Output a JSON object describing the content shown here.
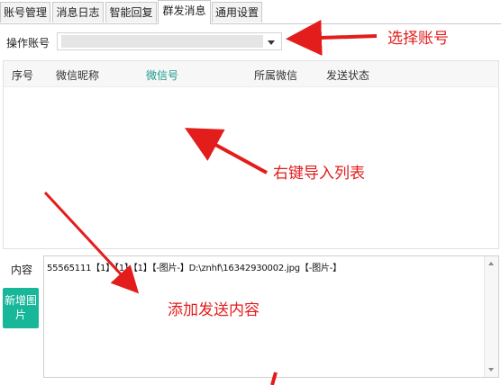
{
  "tabs": [
    {
      "label": "账号管理"
    },
    {
      "label": "消息日志"
    },
    {
      "label": "智能回复"
    },
    {
      "label": "群发消息",
      "active": true
    },
    {
      "label": "通用设置"
    }
  ],
  "account": {
    "label": "操作账号",
    "value": ""
  },
  "list": {
    "headers": [
      "序号",
      "微信昵称",
      "微信号",
      "所属微信",
      "发送状态"
    ]
  },
  "content": {
    "label": "内容",
    "add_image_label": "新增图片",
    "text": "55565111【1】【1】【1】【-图片-】D:\\znhf\\16342930002.jpg【-图片-】"
  },
  "annotations": {
    "select_account": "选择账号",
    "right_click_import": "右键导入列表",
    "add_content": "添加发送内容",
    "color": "#e31c1c"
  }
}
